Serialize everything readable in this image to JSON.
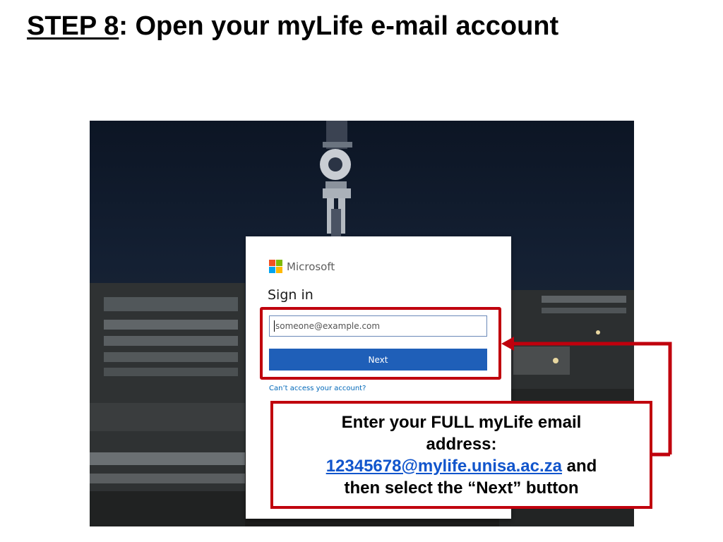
{
  "slide": {
    "step_label": "STEP 8",
    "title_rest": ": Open your myLife e-mail account"
  },
  "signin": {
    "brand": "Microsoft",
    "heading": "Sign in",
    "email_placeholder": "someone@example.com",
    "next_label": "Next",
    "help_link": "Can’t access your account?"
  },
  "callout": {
    "line1": "Enter your FULL myLife email",
    "line2": "address:",
    "email": "12345678@mylife.unisa.ac.za",
    "after_email": " and",
    "line4": "then select the “Next” button"
  },
  "colors": {
    "accent_red": "#c0000d",
    "ms_blue": "#1f5fb8",
    "link_blue": "#0067b8",
    "ms_red": "#f25022",
    "ms_green": "#7fba00",
    "ms_blue_square": "#00a4ef",
    "ms_yellow": "#ffb900"
  }
}
